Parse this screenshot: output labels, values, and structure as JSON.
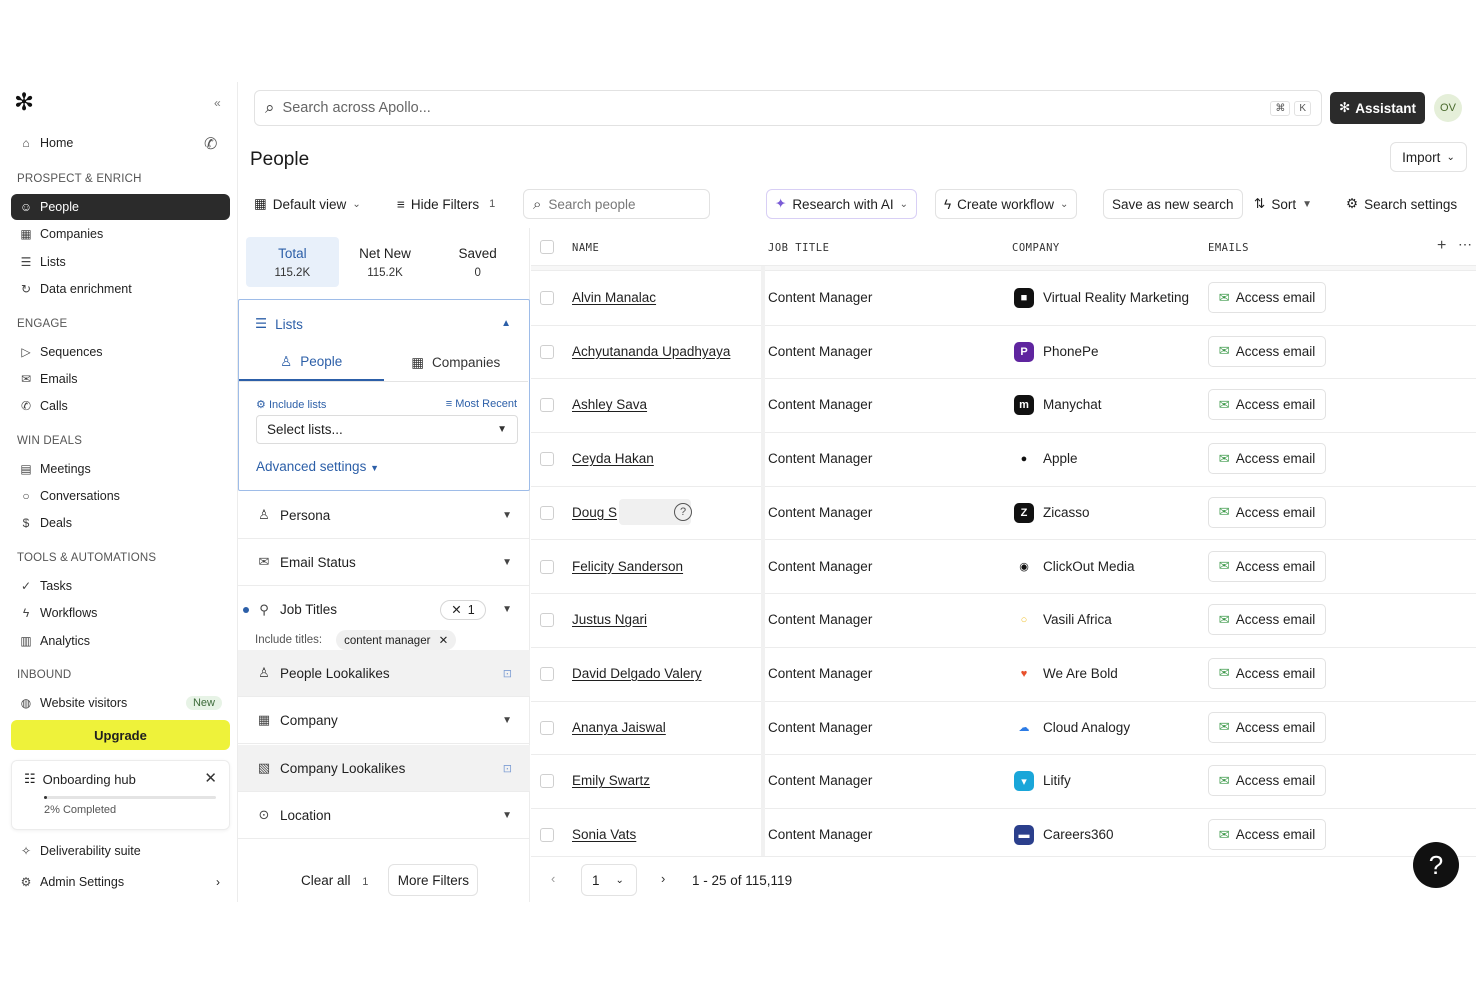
{
  "sidebar": {
    "home": "Home",
    "sections": {
      "prospect": "PROSPECT & ENRICH",
      "engage": "ENGAGE",
      "win": "WIN DEALS",
      "tools": "TOOLS & AUTOMATIONS",
      "inbound": "INBOUND"
    },
    "items": {
      "people": "People",
      "companies": "Companies",
      "lists": "Lists",
      "data_enrichment": "Data enrichment",
      "sequences": "Sequences",
      "emails": "Emails",
      "calls": "Calls",
      "meetings": "Meetings",
      "conversations": "Conversations",
      "deals": "Deals",
      "tasks": "Tasks",
      "workflows": "Workflows",
      "analytics": "Analytics",
      "website_visitors": "Website visitors",
      "new_badge": "New"
    },
    "upgrade": "Upgrade",
    "onboarding": {
      "title": "Onboarding hub",
      "progress_text": "2% Completed",
      "progress": 0.02
    },
    "deliverability": "Deliverability suite",
    "admin": "Admin Settings"
  },
  "top": {
    "search_placeholder": "Search across Apollo...",
    "shortcut_cmd": "⌘",
    "shortcut_key": "K",
    "assistant": "Assistant",
    "avatar": "OV"
  },
  "page": {
    "title": "People",
    "import": "Import"
  },
  "toolbar": {
    "default_view": "Default view",
    "hide_filters": "Hide Filters",
    "hide_filters_count": "1",
    "search_people_placeholder": "Search people",
    "research_ai": "Research with AI",
    "create_workflow": "Create workflow",
    "save_search": "Save as new search",
    "sort": "Sort",
    "search_settings": "Search settings"
  },
  "filters": {
    "stats": [
      {
        "label": "Total",
        "value": "115.2K"
      },
      {
        "label": "Net New",
        "value": "115.2K"
      },
      {
        "label": "Saved",
        "value": "0"
      }
    ],
    "lists": {
      "title": "Lists",
      "tab_people": "People",
      "tab_companies": "Companies",
      "include_lists": "Include lists",
      "most_recent": "Most Recent",
      "select_placeholder": "Select lists...",
      "advanced": "Advanced settings"
    },
    "persona": "Persona",
    "email_status": "Email Status",
    "job_titles": "Job Titles",
    "job_titles_count": "1",
    "include_titles_label": "Include titles:",
    "include_titles_chip": "content manager",
    "people_lookalikes": "People Lookalikes",
    "company": "Company",
    "company_lookalikes": "Company Lookalikes",
    "location": "Location",
    "clear_all": "Clear all",
    "clear_count": "1",
    "more_filters": "More Filters"
  },
  "table": {
    "headers": {
      "name": "NAME",
      "job_title": "JOB TITLE",
      "company": "COMPANY",
      "emails": "EMAILS"
    },
    "access_label": "Access email",
    "rows": [
      {
        "name": "Alvin Manalac",
        "title": "Content Manager",
        "company": "Virtual Reality Marketing",
        "logo_color": "#111111",
        "logo_glyph": "■"
      },
      {
        "name": "Achyutananda Upadhyaya",
        "title": "Content Manager",
        "company": "PhonePe",
        "logo_color": "#5f259f",
        "logo_glyph": "P"
      },
      {
        "name": "Ashley Sava",
        "title": "Content Manager",
        "company": "Manychat",
        "logo_color": "#111111",
        "logo_glyph": "m"
      },
      {
        "name": "Ceyda Hakan",
        "title": "Content Manager",
        "company": "Apple",
        "logo_color": "#ffffff",
        "logo_glyph": "●"
      },
      {
        "name": "Doug S",
        "title": "Content Manager",
        "company": "Zicasso",
        "logo_color": "#111111",
        "logo_glyph": "Z"
      },
      {
        "name": "Felicity Sanderson",
        "title": "Content Manager",
        "company": "ClickOut Media",
        "logo_color": "#ffffff",
        "logo_glyph": "◉"
      },
      {
        "name": "Justus Ngari",
        "title": "Content Manager",
        "company": "Vasili Africa",
        "logo_color": "#ffffff",
        "logo_glyph": "○"
      },
      {
        "name": "David Delgado Valery",
        "title": "Content Manager",
        "company": "We Are Bold",
        "logo_color": "#ffffff",
        "logo_glyph": "♥"
      },
      {
        "name": "Ananya Jaiswal",
        "title": "Content Manager",
        "company": "Cloud Analogy",
        "logo_color": "#ffffff",
        "logo_glyph": "☁"
      },
      {
        "name": "Emily Swartz",
        "title": "Content Manager",
        "company": "Litify",
        "logo_color": "#1aa6d9",
        "logo_glyph": "▾"
      },
      {
        "name": "Sonia Vats",
        "title": "Content Manager",
        "company": "Careers360",
        "logo_color": "#2b3f8c",
        "logo_glyph": "▬"
      }
    ]
  },
  "pager": {
    "page": "1",
    "range": "1 - 25 of 115,119"
  },
  "help": "?"
}
